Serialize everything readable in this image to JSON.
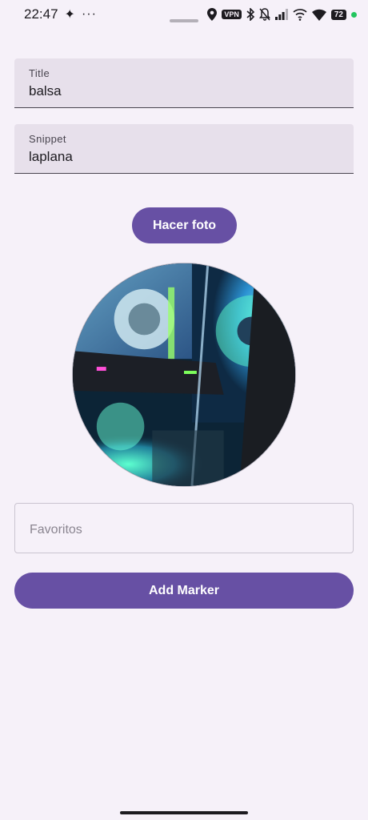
{
  "status_bar": {
    "time": "22:47",
    "extra_indicator": "✦",
    "more_indicator": "···",
    "vpn": "VPN",
    "battery": "72",
    "icons": [
      "location-icon",
      "vpn-icon",
      "bluetooth-icon",
      "mute-icon",
      "signal-icon",
      "wifi-call-icon",
      "wifi-icon",
      "battery-icon"
    ],
    "dot_color": "#22c55e"
  },
  "form": {
    "title": {
      "label": "Title",
      "value": "balsa"
    },
    "snippet": {
      "label": "Snippet",
      "value": "laplana"
    },
    "photo_button": "Hacer foto",
    "favorites": {
      "placeholder": "Favoritos"
    },
    "add_button": "Add Marker"
  },
  "colors": {
    "accent": "#6750a4",
    "background": "#f6f1f9",
    "field_fill": "#e7e0eb"
  }
}
